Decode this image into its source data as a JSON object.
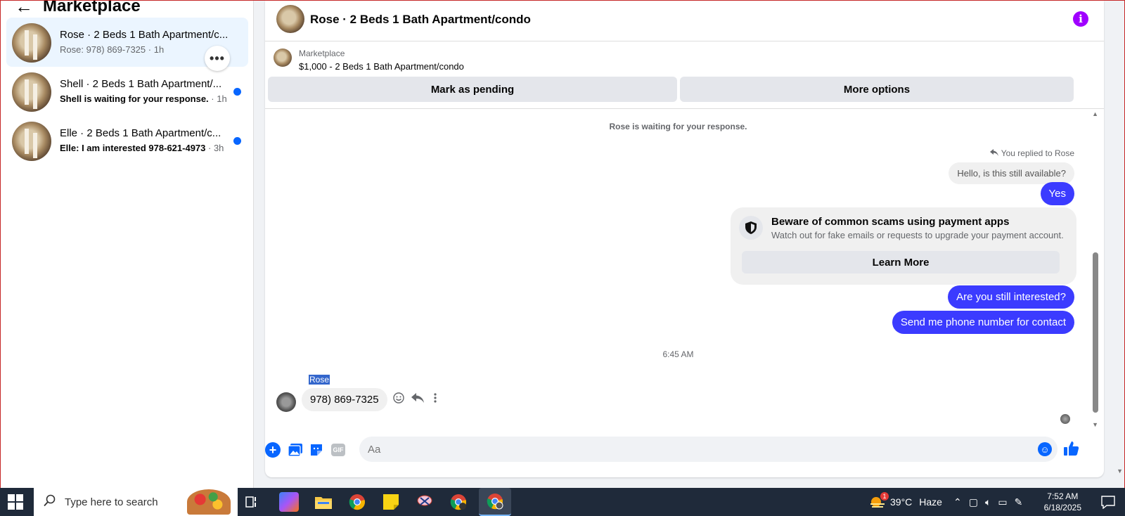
{
  "sidebar": {
    "title": "Marketplace",
    "conversations": [
      {
        "name": "Rose · 2 Beds 1 Bath Apartment/c...",
        "preview": "Rose: 978) 869-7325",
        "time": "· 1h",
        "unread": false
      },
      {
        "name": "Shell · 2 Beds 1 Bath Apartment/...",
        "preview": "Shell is waiting for your response.",
        "time": "· 1h",
        "unread": true
      },
      {
        "name": "Elle · 2 Beds 1 Bath Apartment/c...",
        "preview": "Elle: I am interested 978-621-4973",
        "time": "· 3h",
        "unread": true
      }
    ],
    "more_glyph": "•••"
  },
  "chat": {
    "title": "Rose · 2 Beds 1 Bath Apartment/condo",
    "info_glyph": "i",
    "listing": {
      "source": "Marketplace",
      "price_title": "$1,000 - 2 Beds 1 Bath Apartment/condo",
      "mark_pending": "Mark as pending",
      "more_options": "More options"
    },
    "waiting_notice": "Rose is waiting for your response.",
    "replied_label": "You replied to Rose",
    "quoted_message": "Hello, is this still available?",
    "outgoing_1": "Yes",
    "scam_notice": {
      "title": "Beware of common scams using payment apps",
      "description": "Watch out for fake emails or requests to upgrade your payment account.",
      "button": "Learn More"
    },
    "outgoing_2": "Are you still interested?",
    "outgoing_3": "Send me phone number for contact",
    "timestamp": "6:45 AM",
    "sender_label": "Rose",
    "incoming_1": "978) 869-7325",
    "composer_placeholder": "Aa",
    "gif_label": "GIF"
  },
  "taskbar": {
    "search_placeholder": "Type here to search",
    "weather_temp": "39°C",
    "weather_text": "Haze",
    "weather_badge": "1",
    "time": "7:52 AM",
    "date": "6/18/2025"
  },
  "colors": {
    "accent_blue": "#0866ff",
    "bubble_blue": "#3b3bff",
    "info_purple": "#a000ff"
  }
}
